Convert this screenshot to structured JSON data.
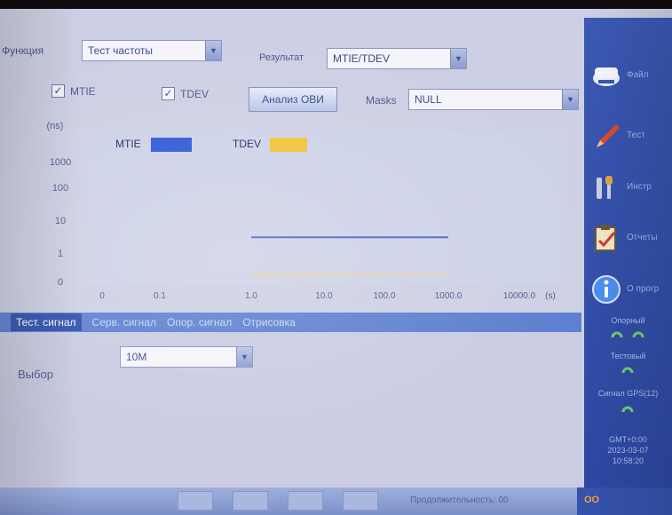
{
  "top": {
    "function_label": "Функция",
    "function_value": "Тест частоты",
    "result_label": "Результат",
    "result_value": "MTIE/TDEV"
  },
  "options": {
    "mtie_label": "MTIE",
    "mtie_checked": true,
    "tdev_label": "TDEV",
    "tdev_checked": true,
    "ovi_button": "Анализ ОВИ",
    "masks_label": "Masks",
    "masks_value": "NULL"
  },
  "chart_data": {
    "type": "line",
    "y_unit": "(ns)",
    "x_unit": "(s)",
    "y_ticks": [
      "0",
      "1",
      "10",
      "100",
      "1000"
    ],
    "x_ticks": [
      "0",
      "0.1",
      "1.0",
      "10.0",
      "100.0",
      "1000.0",
      "10000.0"
    ],
    "legend": [
      {
        "name": "MTIE",
        "color": "#2f57d6"
      },
      {
        "name": "TDEV",
        "color": "#f2c23a"
      }
    ],
    "series": [
      {
        "name": "MTIE",
        "color": "#4a63c8",
        "x": [
          1.0,
          10.0,
          100.0,
          1000.0
        ],
        "y": [
          3,
          3,
          3,
          3
        ]
      },
      {
        "name": "TDEV",
        "color": "#f2d27a",
        "x": [
          1.0,
          10.0,
          100.0,
          1000.0
        ],
        "y": [
          0,
          0,
          0,
          0
        ]
      }
    ],
    "scale": "log",
    "grid": false,
    "legend_placement": "top-left"
  },
  "tabs": [
    {
      "label": "Тест. сигнал",
      "active": true
    },
    {
      "label": "Серв. сигнал",
      "active": false
    },
    {
      "label": "Опор. сигнал",
      "active": false
    },
    {
      "label": "Отрисовка",
      "active": false
    }
  ],
  "panel": {
    "select_label": "Выбор",
    "select_value": "10M"
  },
  "sidebar": {
    "items": [
      {
        "label": "Файл",
        "icon": "floppy-icon"
      },
      {
        "label": "Тест",
        "icon": "pencil-icon"
      },
      {
        "label": "Инстр",
        "icon": "tools-icon"
      },
      {
        "label": "Отчеты",
        "icon": "clipboard-icon"
      },
      {
        "label": "О прогр",
        "icon": "info-icon"
      }
    ],
    "ref_label": "Опорный",
    "test_label": "Тестовый",
    "gps_label": "Сигнал GPS(12)",
    "tz": "GMT+0:00",
    "date": "2023-03-07",
    "time": "10:58:20"
  },
  "statusbar": {
    "duration": "Продолжительность: 00",
    "logo": "OO"
  },
  "colors": {
    "accent": "#3b58b3",
    "tab_active": "#2f4fae",
    "led_green": "#6fcf6a"
  }
}
